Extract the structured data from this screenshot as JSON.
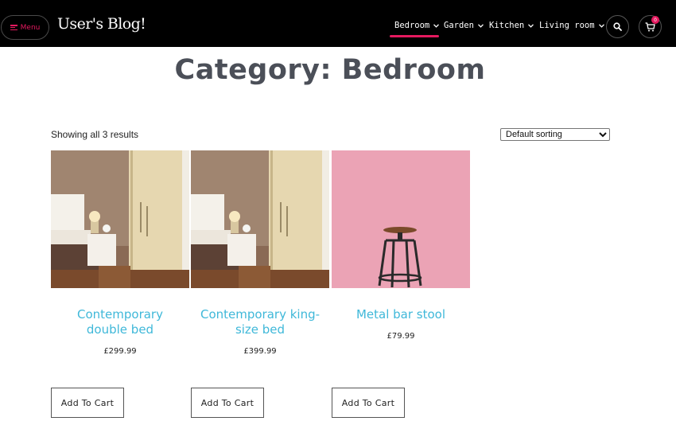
{
  "header": {
    "menu_label": "Menu",
    "site_title": "User's Blog!",
    "nav": [
      {
        "label": "Bedroom"
      },
      {
        "label": "Garden"
      },
      {
        "label": "Kitchen"
      },
      {
        "label": "Living room"
      }
    ],
    "cart_count": "0",
    "icons": {
      "menu": "hamburger-icon",
      "search": "search-icon",
      "cart": "cart-icon",
      "dropdown": "chevron-down-icon"
    }
  },
  "page": {
    "title": "Category: Bedroom",
    "result_count": "Showing all 3 results",
    "sort_selected": "Default sorting"
  },
  "products": [
    {
      "name": "Contemporary double bed",
      "price": "£299.99",
      "button": "Add To Cart"
    },
    {
      "name": "Contemporary king-size bed",
      "price": "£399.99",
      "button": "Add To Cart"
    },
    {
      "name": "Metal bar stool",
      "price": "£79.99",
      "button": "Add To Cart"
    }
  ],
  "colors": {
    "accent": "#e5195f",
    "link": "#3fb8d9",
    "header_bg": "#000000"
  }
}
